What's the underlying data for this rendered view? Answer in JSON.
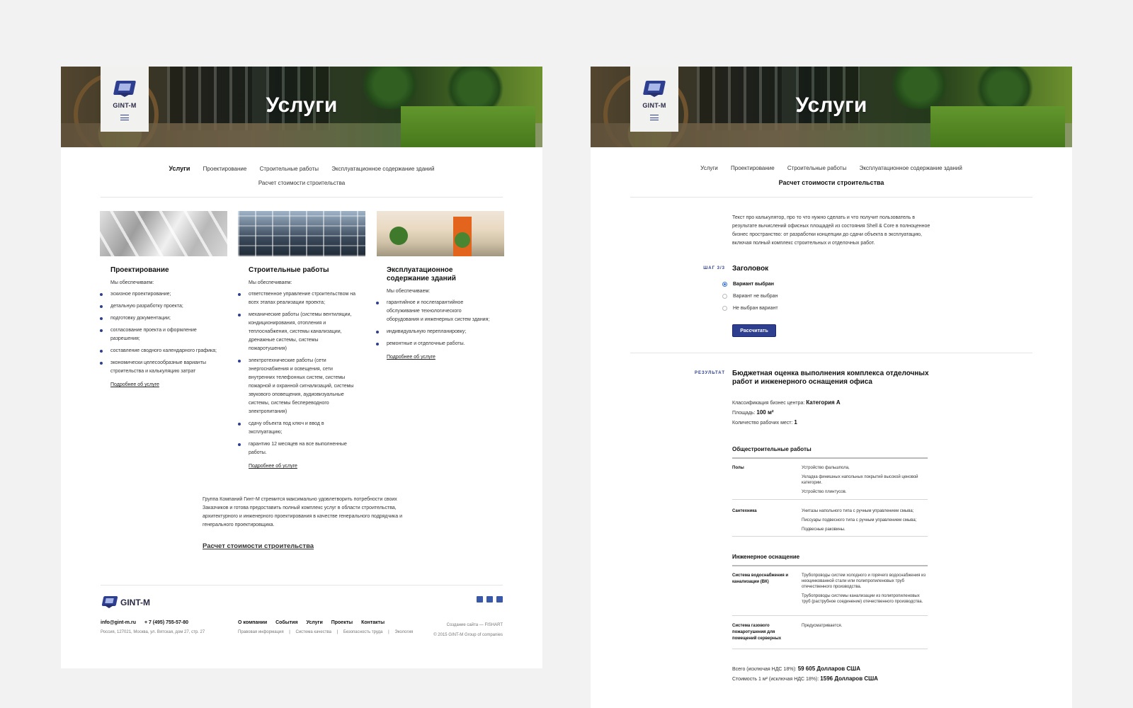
{
  "hero": {
    "title": "Услуги",
    "logo_text": "GINT-M"
  },
  "tabs": {
    "services": "Услуги",
    "design": "Проектирование",
    "construction": "Строительные работы",
    "maintenance": "Эксплуатационное содержание зданий",
    "calc": "Расчет стоимости строительства"
  },
  "services": [
    {
      "title": "Проектирование",
      "lead": "Мы обеспечиваем:",
      "items": [
        "эскизное проектирование;",
        "детальную разработку проекта;",
        "подготовку документации;",
        "согласование проекта и оформление разрешения;",
        "составление сводного календарного графика;",
        "экономически целесообразные варианты строительства и калькуляцию затрат"
      ],
      "more": "Подробнее об услуге"
    },
    {
      "title": "Строительные работы",
      "lead": "Мы обеспечиваем:",
      "items": [
        "ответственное управление строительством на всех этапах реализации проекта;",
        "механические работы (системы вентиляции, кондиционирования, отопления и теплоснабжения, системы канализации, дренажные системы, системы пожаротушения)",
        "электротехнические работы (сети энергоснабжения и освещения, сети внутренних телефонных систем, системы пожарной и охранной сигнализаций, системы звукового оповещения, аудиовизуальные системы, системы беспереводного электропитания)",
        "сдачу объекта под ключ и ввод в эксплуатацию;",
        "гарантию 12 месяцев на все выполненные работы."
      ],
      "more": "Подробнее об услуге"
    },
    {
      "title": "Эксплуатационное содержание зданий",
      "lead": "Мы обеспечиваем:",
      "items": [
        "гарантийное и послегарантийное обслуживание технологического оборудования и инженерных систем здания;",
        "индивидуальную перепланировку;",
        "ремонтные и отделочные работы."
      ],
      "more": "Подробнее об услуге"
    }
  ],
  "about": "Группа Компаний Гинт-М стремится максимально удовлетворить потребности своих Заказчиков и готова предоставить полный комплекс услуг в области строительства, архитектурного и инженерного проектирования в качестве генерального подрядчика и генерального проектировщика.",
  "calc_link": "Расчет стоимости строительства",
  "footer": {
    "logo_text": "GINT-M",
    "email": "info@gint-m.ru",
    "phone": "+ 7 (495) 755-57-80",
    "address": "Россия, 127021, Москва, ул. Вятская, дом 27, стр. 27",
    "nav": [
      "О компании",
      "События",
      "Услуги",
      "Проекты",
      "Контакты"
    ],
    "subnav": [
      "Правовая информация",
      "|",
      "Система качества",
      "|",
      "Безопасность труда",
      "|",
      "Экология"
    ],
    "credit": "Создание сайта — FISHART",
    "copyright": "© 2015 GINT-M Group of companies"
  },
  "calc": {
    "intro": "Текст про калькулятор, про то что нужно сделать и что получит пользователь в результате вычислений офисных площадей из состояния Shell & Core в полноценное бизнес пространство: от разработки концепции до сдачи объекта в эксплуатацию, включая полный комплекс строительных и отделочных работ.",
    "step_tag": "ШАГ 3/3",
    "step_title": "Заголовок",
    "options": [
      "Вариант выбран",
      "Вариант не выбран",
      "Не выбран вариант"
    ],
    "button": "Рассчитать",
    "result_tag": "РЕЗУЛЬТАТ",
    "result_title": "Бюджетная оценка выполнения комплекса отделочных работ и инженерного оснащения офиса",
    "class_label": "Классификация бизнес центра:",
    "class_value": "Категория А",
    "area_label": "Площадь:",
    "area_value": "100 м²",
    "seats_label": "Количество рабочих мест:",
    "seats_value": "1",
    "sections": [
      {
        "title": "Общестроительные работы",
        "rows": [
          {
            "key": "Полы",
            "values": [
              "Устройство фальшпола,",
              "Укладка финишных напольных покрытий высокой ценовой категории.",
              "Устройство плинтусов."
            ]
          },
          {
            "key": "Сантехника",
            "values": [
              "Унитазы напольного типа с ручным управлением смыва;",
              "Писсуары подвесного типа с ручным управлением смыва;",
              "Подвесные раковины."
            ]
          }
        ]
      },
      {
        "title": "Инженерное оснащение",
        "rows": [
          {
            "key": "Система водоснабжения и канализации (ВК)",
            "values": [
              "Трубопроводы систем холодного и горячего водоснабжения из неоцинкованной стали или полипропиленовых труб отечественного производства.",
              "Трубопроводы системы канализации из полипропиленовых труб (раструбное соединение) отечественного производства."
            ]
          },
          {
            "key": "Система газового пожаротушения для помещений серверных",
            "values": [
              "Предусматривается."
            ]
          }
        ]
      }
    ],
    "total_label": "Всего (исключая НДС 18%):",
    "total_value": "59 605 Долларов США",
    "unit_label": "Стоимость 1 м² (исключая НДС 18%):",
    "unit_value": "1596 Долларов США"
  }
}
